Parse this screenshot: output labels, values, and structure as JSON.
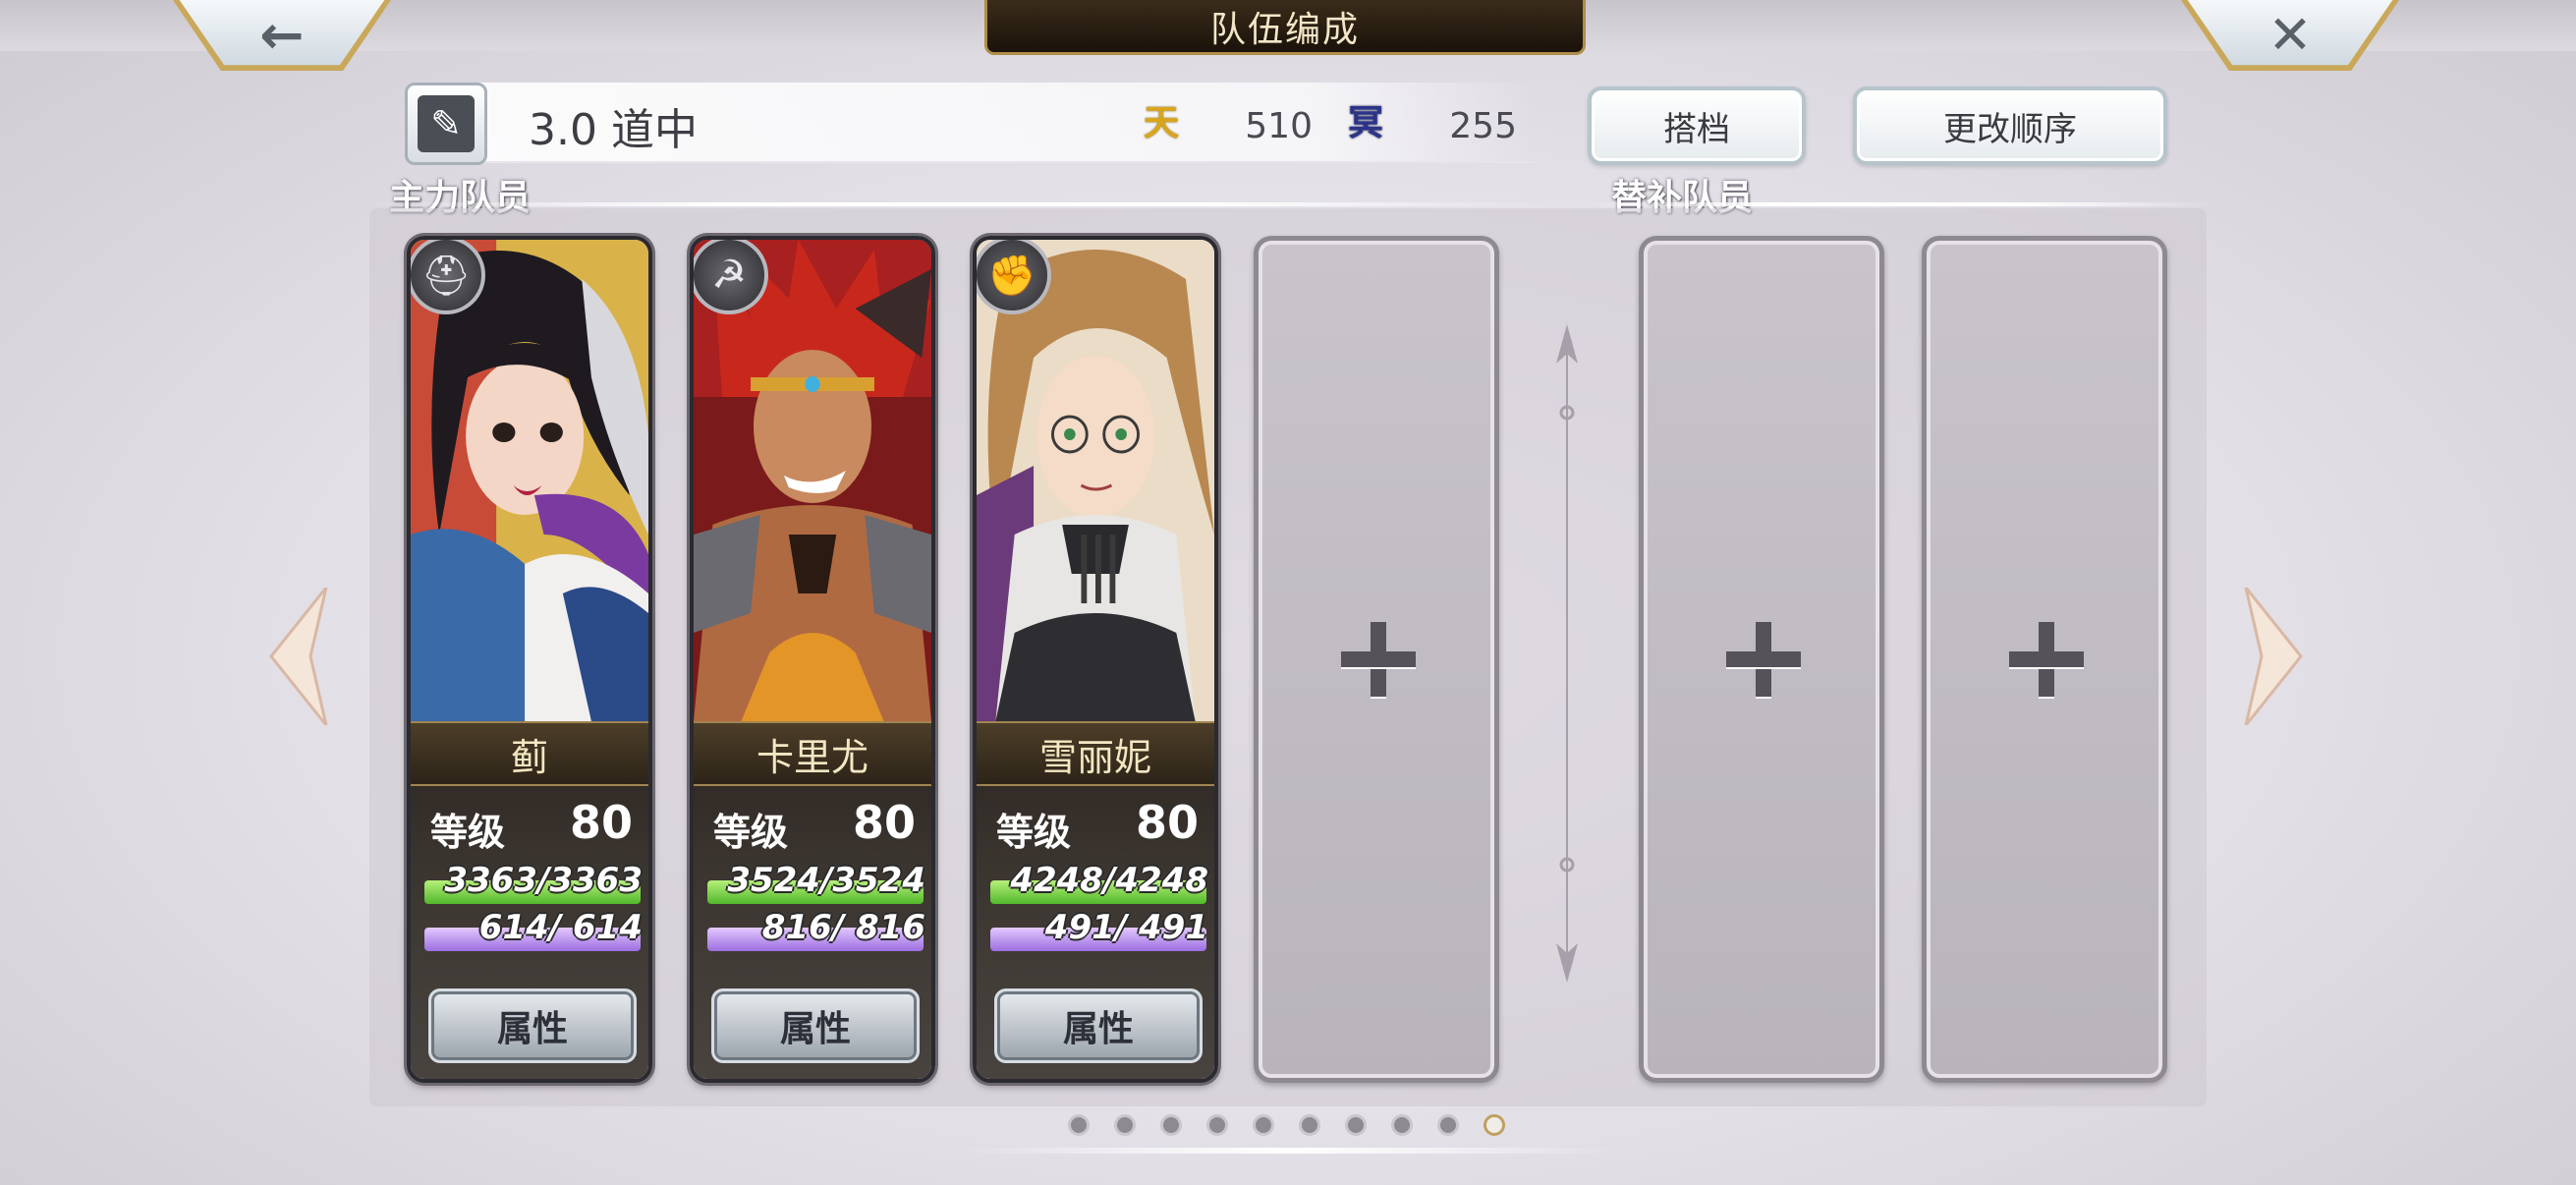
{
  "header": {
    "title": "队伍编成",
    "back_icon": "arrow-left-icon",
    "close_icon": "close-icon"
  },
  "team": {
    "name": "3.0 道中",
    "resource_heaven_glyph": "天",
    "resource_heaven_value": "510",
    "resource_dark_glyph": "冥",
    "resource_dark_value": "255",
    "partner_label": "搭档",
    "reorder_label": "更改顺序"
  },
  "sections": {
    "main_label": "主力队员",
    "sub_label": "替补队员"
  },
  "members": [
    {
      "name": "蓟",
      "class_icon": "helmet-icon",
      "level_label": "等级",
      "level": "80",
      "hp": "3363/3363",
      "mp": "614/ 614",
      "attr_label": "属性",
      "colors": {
        "hair": "#1e1a20",
        "accent": "#7a3aa0",
        "bg": "#c6a040"
      }
    },
    {
      "name": "卡里尤",
      "class_icon": "scythe-icon",
      "level_label": "等级",
      "level": "80",
      "hp": "3524/3524",
      "mp": "816/ 816",
      "attr_label": "属性",
      "colors": {
        "hair": "#c32a20",
        "accent": "#d8a030",
        "bg": "#7a1a1a"
      }
    },
    {
      "name": "雪丽妮",
      "class_icon": "fist-icon",
      "level_label": "等级",
      "level": "80",
      "hp": "4248/4248",
      "mp": "491/ 491",
      "attr_label": "属性",
      "colors": {
        "hair": "#b88850",
        "accent": "#3a3a3a",
        "bg": "#e8d8c0"
      }
    }
  ],
  "pagination": {
    "count": 10,
    "active": 10
  }
}
